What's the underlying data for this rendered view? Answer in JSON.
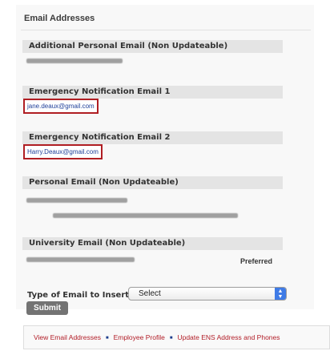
{
  "section": {
    "title": "Email Addresses"
  },
  "fields": [
    {
      "label": "Additional Personal Email (Non Updateable)",
      "value": ""
    },
    {
      "label": "Emergency Notification Email 1",
      "value": "jane.deaux@gmail.com"
    },
    {
      "label": "Emergency Notification Email 2",
      "value": "Harry.Deaux@gmail.com"
    },
    {
      "label": "Personal Email (Non Updateable)",
      "value": ""
    },
    {
      "label": "University Email (Non Updateable)",
      "value": "",
      "badge": "Preferred"
    }
  ],
  "insert": {
    "label": "Type of Email to Insert:",
    "selected": "Select",
    "submit_label": "Submit"
  },
  "nav": {
    "links": [
      "View Email Addresses",
      "Employee Profile",
      "Update ENS Address and Phones"
    ]
  },
  "colors": {
    "highlight_border": "#b01e23",
    "link": "#b21e28",
    "separator": "#1b3c8c"
  }
}
